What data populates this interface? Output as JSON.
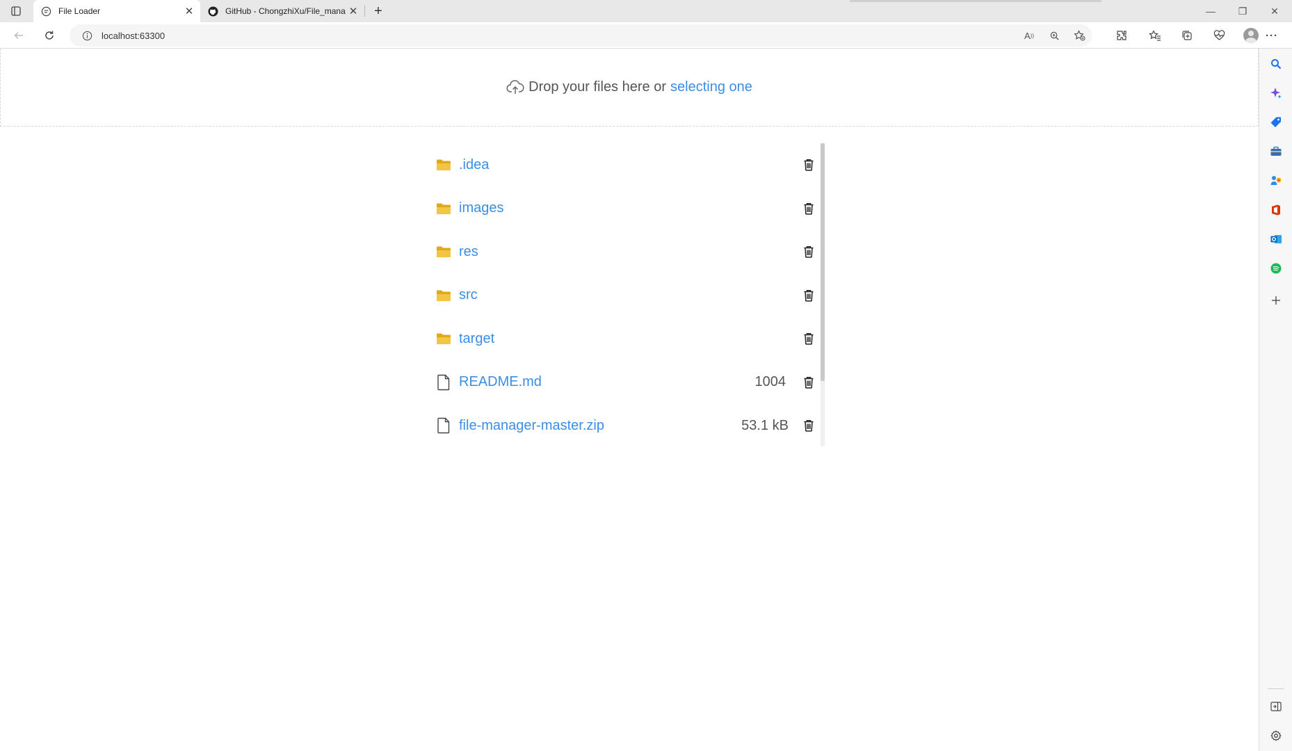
{
  "browser": {
    "tabs": [
      {
        "title": "File Loader",
        "active": true,
        "favicon": "chat-page-icon"
      },
      {
        "title": "GitHub - ChongzhiXu/File_mana",
        "active": false,
        "favicon": "github-icon"
      }
    ],
    "close_glyph": "✕",
    "new_tab_glyph": "+",
    "window_controls": {
      "minimize": "—",
      "restore": "❐",
      "close": "✕"
    },
    "url": "localhost:63300",
    "toolbar_icons": [
      "read-aloud-icon",
      "zoom-icon",
      "favorite-add-icon",
      "extensions-icon",
      "favorites-icon",
      "collections-icon",
      "browser-essentials-icon",
      "profile-icon",
      "more-icon"
    ],
    "read_aloud_glyph": "A",
    "more_glyph": "···",
    "sidebar_icons": [
      "search-icon",
      "copilot-icon",
      "shopping-icon",
      "tools-icon",
      "games-icon",
      "office-icon",
      "outlook-icon",
      "spotify-icon",
      "add-icon",
      "hide-sidebar-icon",
      "settings-icon"
    ]
  },
  "dropzone": {
    "text": "Drop your files here or",
    "link": "selecting one"
  },
  "files": [
    {
      "name": ".idea",
      "type": "folder",
      "size": ""
    },
    {
      "name": "images",
      "type": "folder",
      "size": ""
    },
    {
      "name": "res",
      "type": "folder",
      "size": ""
    },
    {
      "name": "src",
      "type": "folder",
      "size": ""
    },
    {
      "name": "target",
      "type": "folder",
      "size": ""
    },
    {
      "name": "README.md",
      "type": "file",
      "size": "1004"
    },
    {
      "name": "file-manager-master.zip",
      "type": "file",
      "size": "53.1 kB"
    }
  ],
  "colors": {
    "link": "#3a8ee6",
    "folder": "#f4c542",
    "tab_bar": "#e8e8e8"
  }
}
